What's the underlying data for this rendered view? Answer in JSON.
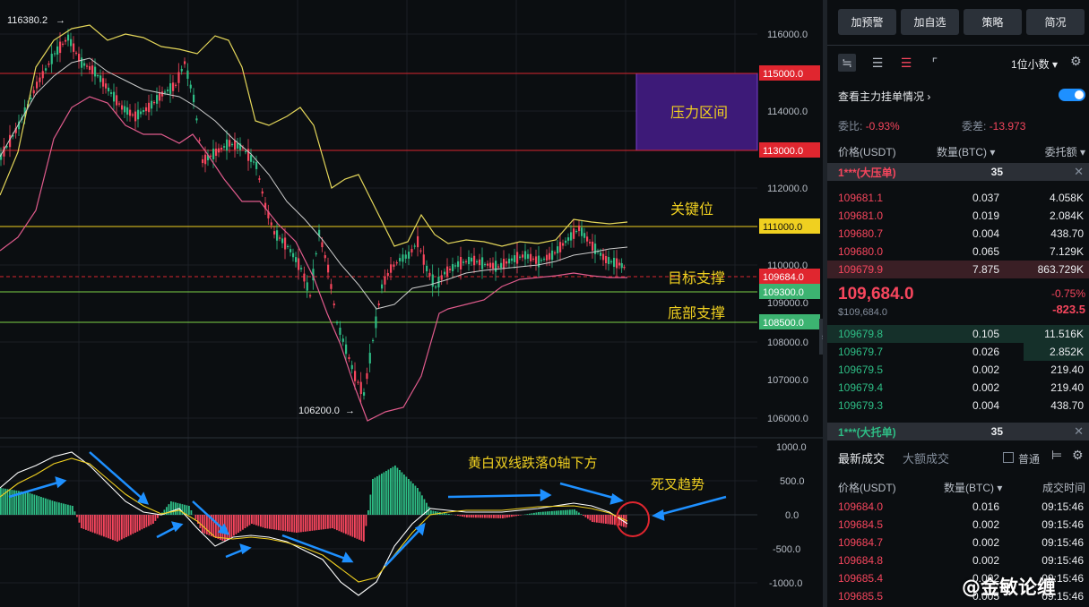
{
  "chart": {
    "high_marker": "116380.2",
    "low_marker": "106200.0",
    "price_ticks": [
      "116000.0",
      "115000.0",
      "114000.0",
      "113000.0",
      "112000.0",
      "111000.0",
      "110000.0",
      "109684.0",
      "109300.0",
      "109000.0",
      "108500.0",
      "108000.0",
      "107000.0",
      "106000.0"
    ],
    "macd_ticks": [
      "1000.0",
      "500.0",
      "0.0",
      "-500.0",
      "-1000.0"
    ],
    "tags": [
      {
        "label": "115000.0",
        "color": "#e0262f",
        "text_color": "#ffffff"
      },
      {
        "label": "113000.0",
        "color": "#e0262f",
        "text_color": "#ffffff"
      },
      {
        "label": "111000.0",
        "color": "#f0d020",
        "text_color": "#111111"
      },
      {
        "label": "109684.0",
        "color": "#e0262f",
        "text_color": "#ffffff"
      },
      {
        "label": "109300.0",
        "color": "#3cb371",
        "text_color": "#ffffff"
      },
      {
        "label": "108500.0",
        "color": "#3cb371",
        "text_color": "#ffffff"
      }
    ],
    "annotations": {
      "pressure_zone": "压力区间",
      "key_level": "关键位",
      "target_support": "目标支撑",
      "bottom_support": "底部支撑",
      "macd_note": "黄白双线跌落0轴下方",
      "death_cross": "死叉趋势"
    },
    "watermark": "@金敏论缠"
  },
  "panel": {
    "buttons": [
      "加预警",
      "加自选",
      "策略",
      "简况"
    ],
    "decimal_select": "1位小数",
    "main_order_label": "查看主力挂单情况",
    "ratio_label": "委比:",
    "ratio_value": "-0.93%",
    "diff_label": "委差:",
    "diff_value": "-13.973",
    "col_price": "价格(USDT)",
    "col_qty": "数量(BTC)",
    "col_total": "委托额",
    "big_ask_label": "1***(大压单)",
    "big_ask_qty": "35",
    "asks": [
      {
        "p": "109681.1",
        "q": "0.037",
        "t": "4.058K"
      },
      {
        "p": "109681.0",
        "q": "0.019",
        "t": "2.084K"
      },
      {
        "p": "109680.7",
        "q": "0.004",
        "t": "438.70"
      },
      {
        "p": "109680.0",
        "q": "0.065",
        "t": "7.129K"
      },
      {
        "p": "109679.9",
        "q": "7.875",
        "t": "863.729K"
      }
    ],
    "last_price": "109,684.0",
    "last_price_usd": "$109,684.0",
    "change_pct": "-0.75%",
    "change_abs": "-823.5",
    "bids": [
      {
        "p": "109679.8",
        "q": "0.105",
        "t": "11.516K"
      },
      {
        "p": "109679.7",
        "q": "0.026",
        "t": "2.852K"
      },
      {
        "p": "109679.5",
        "q": "0.002",
        "t": "219.40"
      },
      {
        "p": "109679.4",
        "q": "0.002",
        "t": "219.40"
      },
      {
        "p": "109679.3",
        "q": "0.004",
        "t": "438.70"
      }
    ],
    "big_bid_label": "1***(大托单)",
    "big_bid_qty": "35",
    "trade_tab_latest": "最新成交",
    "trade_tab_large": "大额成交",
    "normal_label": "普通",
    "trade_col_price": "价格(USDT)",
    "trade_col_qty": "数量(BTC)",
    "trade_col_time": "成交时间",
    "trades": [
      {
        "p": "109684.0",
        "q": "0.016",
        "t": "09:15:46"
      },
      {
        "p": "109684.5",
        "q": "0.002",
        "t": "09:15:46"
      },
      {
        "p": "109684.7",
        "q": "0.002",
        "t": "09:15:46"
      },
      {
        "p": "109684.8",
        "q": "0.002",
        "t": "09:15:46"
      },
      {
        "p": "109685.4",
        "q": "0.002",
        "t": "09:15:46"
      },
      {
        "p": "109685.5",
        "q": "0.005",
        "t": "09:15:46"
      }
    ]
  }
}
